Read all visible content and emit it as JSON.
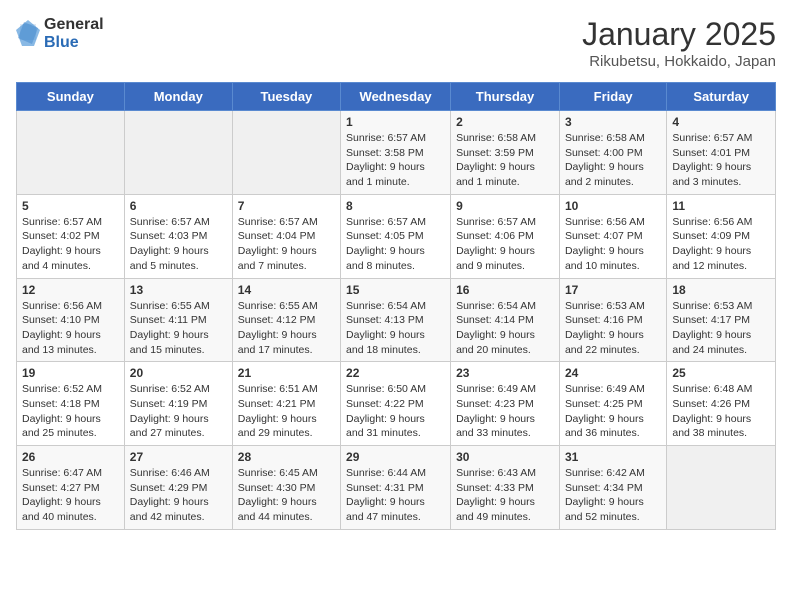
{
  "logo": {
    "general": "General",
    "blue": "Blue"
  },
  "title": "January 2025",
  "location": "Rikubetsu, Hokkaido, Japan",
  "weekdays": [
    "Sunday",
    "Monday",
    "Tuesday",
    "Wednesday",
    "Thursday",
    "Friday",
    "Saturday"
  ],
  "weeks": [
    [
      {
        "day": "",
        "info": ""
      },
      {
        "day": "",
        "info": ""
      },
      {
        "day": "",
        "info": ""
      },
      {
        "day": "1",
        "info": "Sunrise: 6:57 AM\nSunset: 3:58 PM\nDaylight: 9 hours and 1 minute."
      },
      {
        "day": "2",
        "info": "Sunrise: 6:58 AM\nSunset: 3:59 PM\nDaylight: 9 hours and 1 minute."
      },
      {
        "day": "3",
        "info": "Sunrise: 6:58 AM\nSunset: 4:00 PM\nDaylight: 9 hours and 2 minutes."
      },
      {
        "day": "4",
        "info": "Sunrise: 6:57 AM\nSunset: 4:01 PM\nDaylight: 9 hours and 3 minutes."
      }
    ],
    [
      {
        "day": "5",
        "info": "Sunrise: 6:57 AM\nSunset: 4:02 PM\nDaylight: 9 hours and 4 minutes."
      },
      {
        "day": "6",
        "info": "Sunrise: 6:57 AM\nSunset: 4:03 PM\nDaylight: 9 hours and 5 minutes."
      },
      {
        "day": "7",
        "info": "Sunrise: 6:57 AM\nSunset: 4:04 PM\nDaylight: 9 hours and 7 minutes."
      },
      {
        "day": "8",
        "info": "Sunrise: 6:57 AM\nSunset: 4:05 PM\nDaylight: 9 hours and 8 minutes."
      },
      {
        "day": "9",
        "info": "Sunrise: 6:57 AM\nSunset: 4:06 PM\nDaylight: 9 hours and 9 minutes."
      },
      {
        "day": "10",
        "info": "Sunrise: 6:56 AM\nSunset: 4:07 PM\nDaylight: 9 hours and 10 minutes."
      },
      {
        "day": "11",
        "info": "Sunrise: 6:56 AM\nSunset: 4:09 PM\nDaylight: 9 hours and 12 minutes."
      }
    ],
    [
      {
        "day": "12",
        "info": "Sunrise: 6:56 AM\nSunset: 4:10 PM\nDaylight: 9 hours and 13 minutes."
      },
      {
        "day": "13",
        "info": "Sunrise: 6:55 AM\nSunset: 4:11 PM\nDaylight: 9 hours and 15 minutes."
      },
      {
        "day": "14",
        "info": "Sunrise: 6:55 AM\nSunset: 4:12 PM\nDaylight: 9 hours and 17 minutes."
      },
      {
        "day": "15",
        "info": "Sunrise: 6:54 AM\nSunset: 4:13 PM\nDaylight: 9 hours and 18 minutes."
      },
      {
        "day": "16",
        "info": "Sunrise: 6:54 AM\nSunset: 4:14 PM\nDaylight: 9 hours and 20 minutes."
      },
      {
        "day": "17",
        "info": "Sunrise: 6:53 AM\nSunset: 4:16 PM\nDaylight: 9 hours and 22 minutes."
      },
      {
        "day": "18",
        "info": "Sunrise: 6:53 AM\nSunset: 4:17 PM\nDaylight: 9 hours and 24 minutes."
      }
    ],
    [
      {
        "day": "19",
        "info": "Sunrise: 6:52 AM\nSunset: 4:18 PM\nDaylight: 9 hours and 25 minutes."
      },
      {
        "day": "20",
        "info": "Sunrise: 6:52 AM\nSunset: 4:19 PM\nDaylight: 9 hours and 27 minutes."
      },
      {
        "day": "21",
        "info": "Sunrise: 6:51 AM\nSunset: 4:21 PM\nDaylight: 9 hours and 29 minutes."
      },
      {
        "day": "22",
        "info": "Sunrise: 6:50 AM\nSunset: 4:22 PM\nDaylight: 9 hours and 31 minutes."
      },
      {
        "day": "23",
        "info": "Sunrise: 6:49 AM\nSunset: 4:23 PM\nDaylight: 9 hours and 33 minutes."
      },
      {
        "day": "24",
        "info": "Sunrise: 6:49 AM\nSunset: 4:25 PM\nDaylight: 9 hours and 36 minutes."
      },
      {
        "day": "25",
        "info": "Sunrise: 6:48 AM\nSunset: 4:26 PM\nDaylight: 9 hours and 38 minutes."
      }
    ],
    [
      {
        "day": "26",
        "info": "Sunrise: 6:47 AM\nSunset: 4:27 PM\nDaylight: 9 hours and 40 minutes."
      },
      {
        "day": "27",
        "info": "Sunrise: 6:46 AM\nSunset: 4:29 PM\nDaylight: 9 hours and 42 minutes."
      },
      {
        "day": "28",
        "info": "Sunrise: 6:45 AM\nSunset: 4:30 PM\nDaylight: 9 hours and 44 minutes."
      },
      {
        "day": "29",
        "info": "Sunrise: 6:44 AM\nSunset: 4:31 PM\nDaylight: 9 hours and 47 minutes."
      },
      {
        "day": "30",
        "info": "Sunrise: 6:43 AM\nSunset: 4:33 PM\nDaylight: 9 hours and 49 minutes."
      },
      {
        "day": "31",
        "info": "Sunrise: 6:42 AM\nSunset: 4:34 PM\nDaylight: 9 hours and 52 minutes."
      },
      {
        "day": "",
        "info": ""
      }
    ]
  ]
}
